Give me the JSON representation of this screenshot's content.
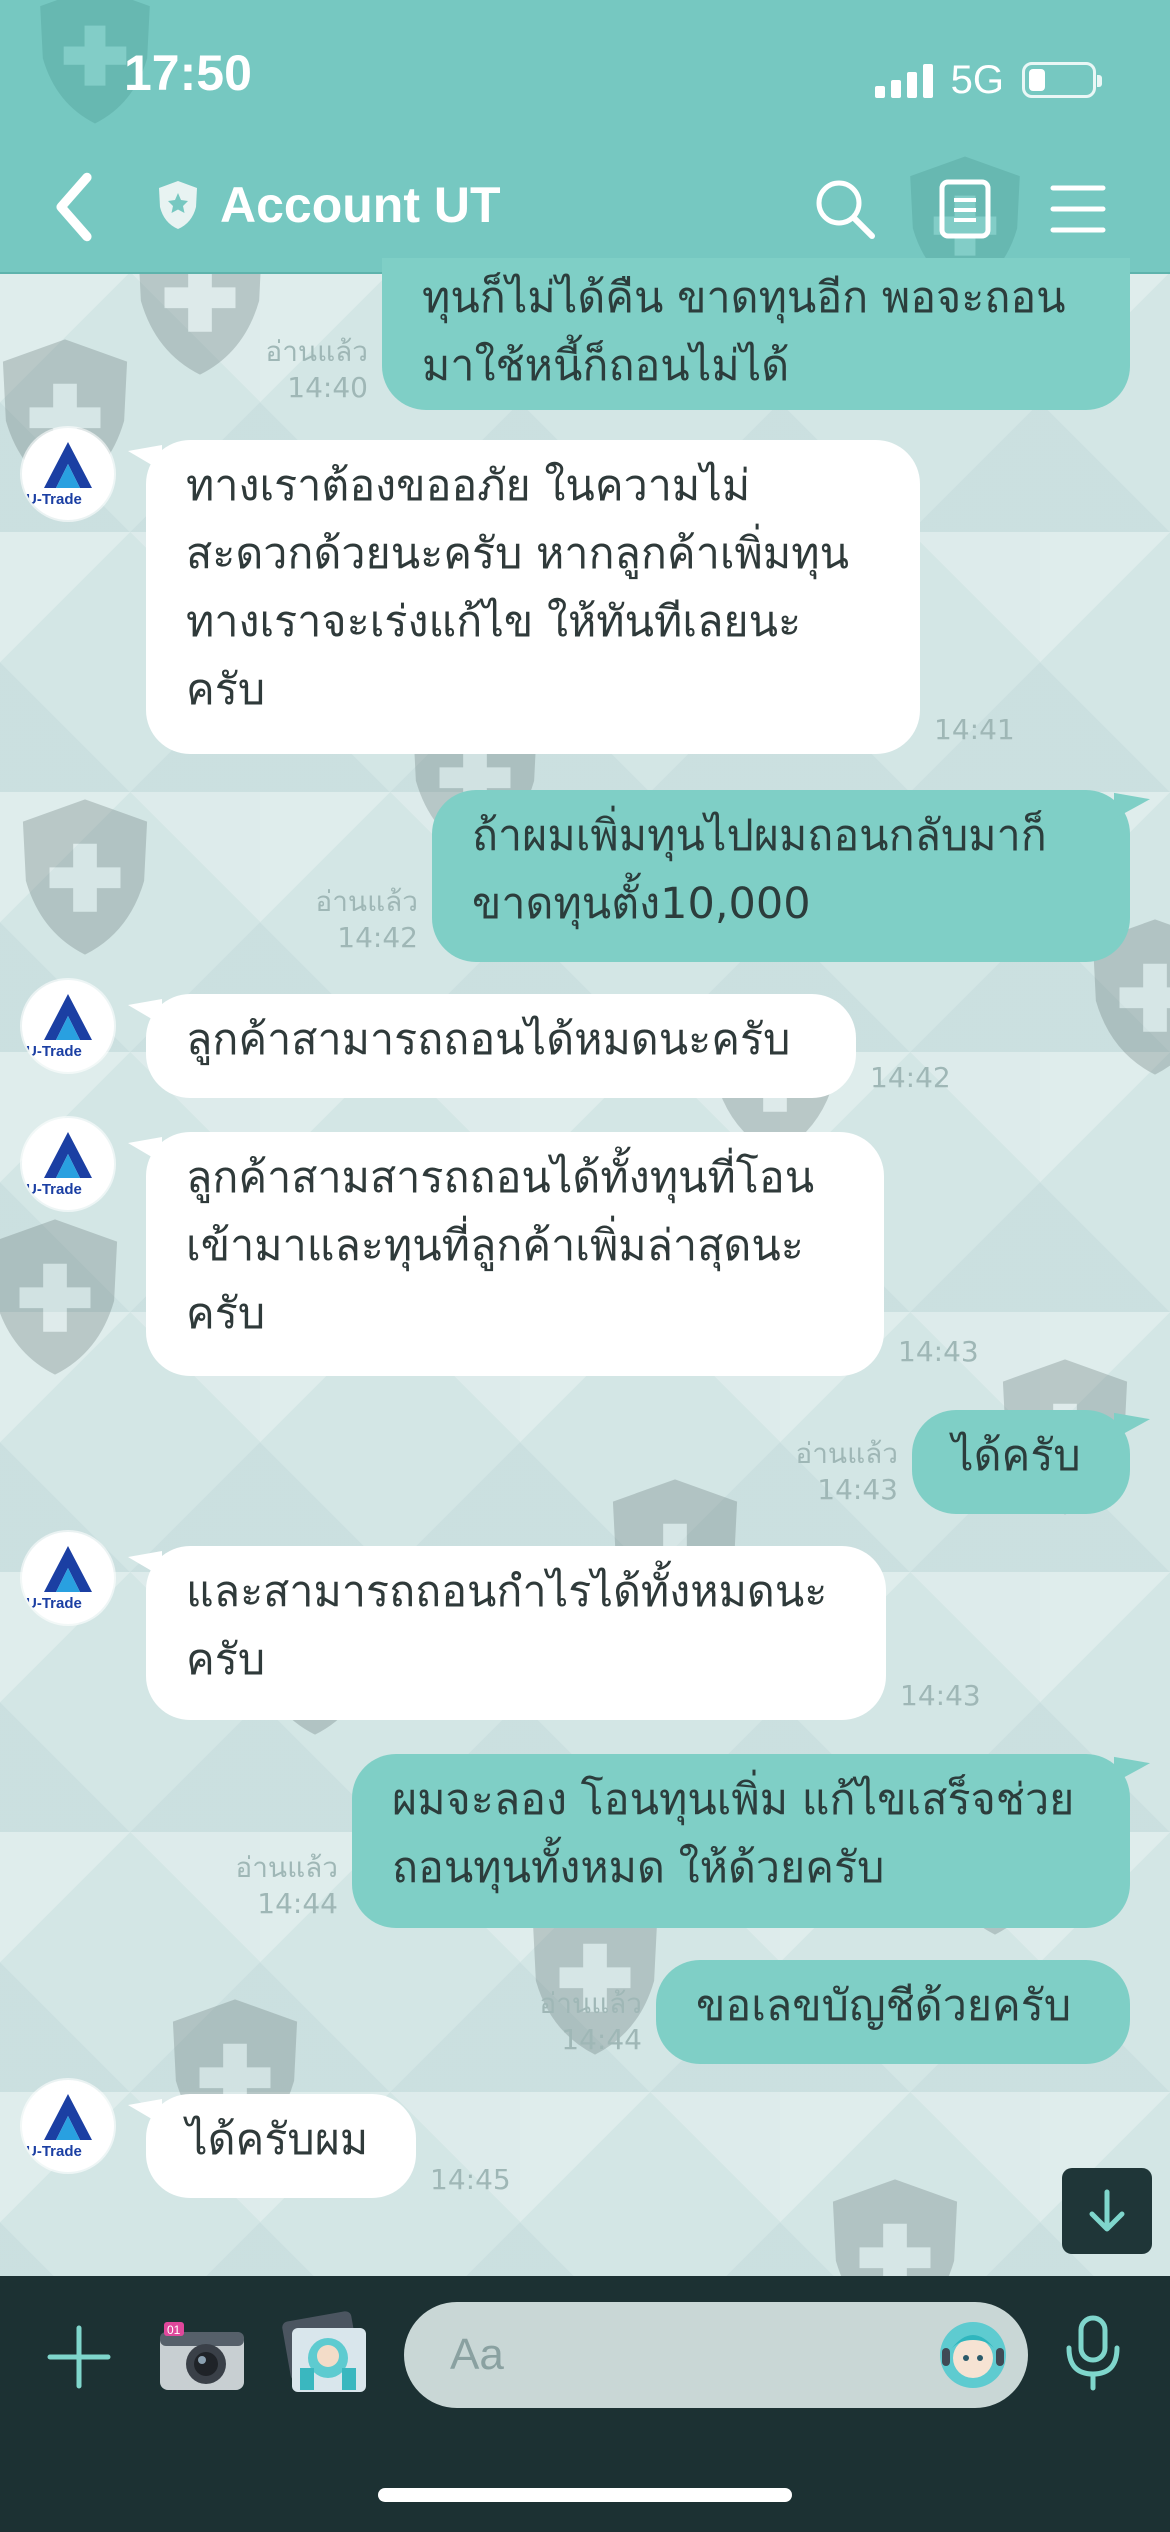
{
  "status_bar": {
    "time": "17:50",
    "network": "5G",
    "battery_level": 0.25
  },
  "header": {
    "title": "Account UT",
    "back_icon": "chevron-left-icon",
    "search_icon": "search-icon",
    "notes_icon": "notes-icon",
    "menu_icon": "menu-icon"
  },
  "colors": {
    "header": "#76c8c1",
    "outgoing_bubble": "#7fcfc6",
    "incoming_bubble": "#ffffff",
    "input_bar": "#1c3133"
  },
  "avatar_label": "U-Trade",
  "read_label": "อ่านแล้ว",
  "messages": [
    {
      "direction": "out",
      "text": "ทุนก็ไม่ได้คืน ขาดทุนอีก พอจะถอน\nมาใช้หนี้ก็ถอนไม่ได้",
      "time": "14:40",
      "read": true
    },
    {
      "direction": "in",
      "text": "ทางเราต้องขออภัย ในความไม่\nสะดวกด้วยนะครับ หากลูกค้าเพิ่มทุน\nทางเราจะเร่งแก้ไข ให้ทันทีเลยนะ\nครับ",
      "time": "14:41"
    },
    {
      "direction": "out",
      "text": "ถ้าผมเพิ่มทุนไปผมถอนกลับมาก็\nขาดทุนตั้ง10,000",
      "time": "14:42",
      "read": true
    },
    {
      "direction": "in",
      "text": "ลูกค้าสามารถถอนได้หมดนะครับ",
      "time": "14:42"
    },
    {
      "direction": "in",
      "text": "ลูกค้าสามสารถถอนได้ทั้งทุนที่โอน\nเข้ามาและทุนที่ลูกค้าเพิ่มล่าสุดนะ\nครับ",
      "time": "14:43"
    },
    {
      "direction": "out",
      "text": "ได้ครับ",
      "time": "14:43",
      "read": true
    },
    {
      "direction": "in",
      "text": "และสามารถถอนกำไรได้ทั้งหมดนะ\nครับ",
      "time": "14:43"
    },
    {
      "direction": "out",
      "text": "ผมจะลอง โอนทุนเพิ่ม แก้ไขเสร็จช่วย\nถอนทุนทั้งหมด ให้ด้วยครับ",
      "time": "14:44",
      "read": true
    },
    {
      "direction": "out",
      "text": "ขอเลขบัญชีด้วยครับ",
      "time": "14:44",
      "read": true
    },
    {
      "direction": "in",
      "text": "ได้ครับผม",
      "time": "14:45"
    }
  ],
  "input": {
    "placeholder": "Aa",
    "plus_icon": "plus-icon",
    "camera_icon": "camera-icon",
    "photo_icon": "photo-icon",
    "sticker_icon": "sticker-icon",
    "mic_icon": "microphone-icon",
    "scroll_icon": "arrow-down-icon"
  }
}
